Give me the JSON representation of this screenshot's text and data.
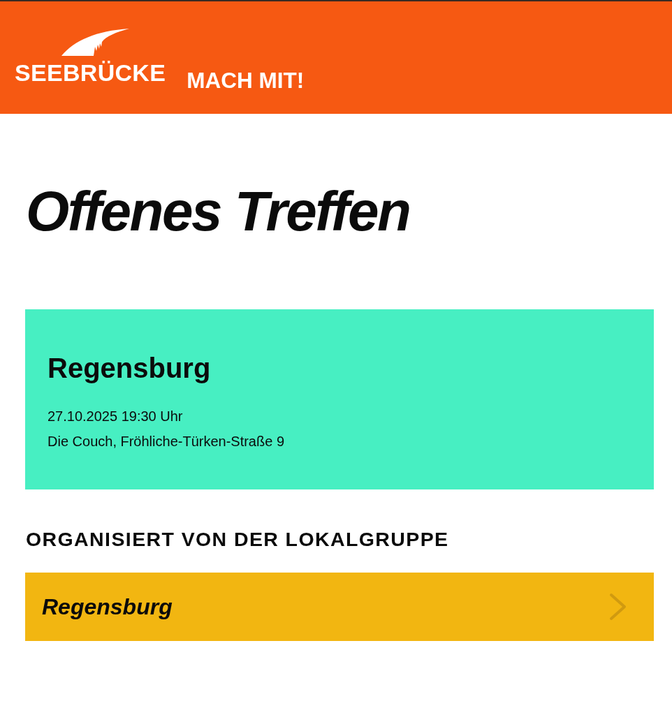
{
  "header": {
    "logo_text": "SEEBRÜCKE",
    "nav_link": "MACH MIT!"
  },
  "title": "Offenes Treffen",
  "event": {
    "city": "Regensburg",
    "datetime": "27.10.2025 19:30 Uhr",
    "location": "Die Couch, Fröhliche-Türken-Straße 9"
  },
  "organizer": {
    "heading": "ORGANISIERT VON DER LOKALGRUPPE",
    "group": "Regensburg"
  }
}
